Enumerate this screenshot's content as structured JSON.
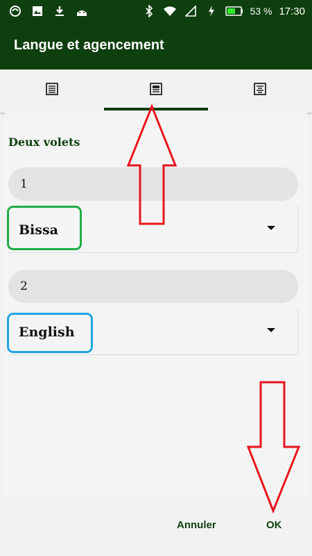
{
  "status_bar": {
    "battery": "53 %",
    "time": "17:30",
    "left_icons": [
      "app-icon",
      "image-icon",
      "download-icon",
      "android-icon"
    ],
    "right_icons": [
      "bluetooth-icon",
      "wifi-icon",
      "signal-icon",
      "charging-icon",
      "battery-icon"
    ]
  },
  "toolbar": {
    "title": "Langue et agencement"
  },
  "tabs": [
    {
      "icon": "single-pane-icon",
      "selected": false
    },
    {
      "icon": "two-pane-icon",
      "selected": true
    },
    {
      "icon": "three-pane-icon",
      "selected": false
    }
  ],
  "layout": {
    "section_title": "Deux volets",
    "panes": [
      {
        "label": "1",
        "language": "Bissa"
      },
      {
        "label": "2",
        "language": "English"
      }
    ]
  },
  "buttons": {
    "cancel": "Annuler",
    "ok": "OK"
  },
  "colors": {
    "primary": "#0e3f0e",
    "highlight_green": "#1fae46",
    "highlight_blue": "#1ea5e0",
    "annotation_arrow": "#e8141c"
  }
}
